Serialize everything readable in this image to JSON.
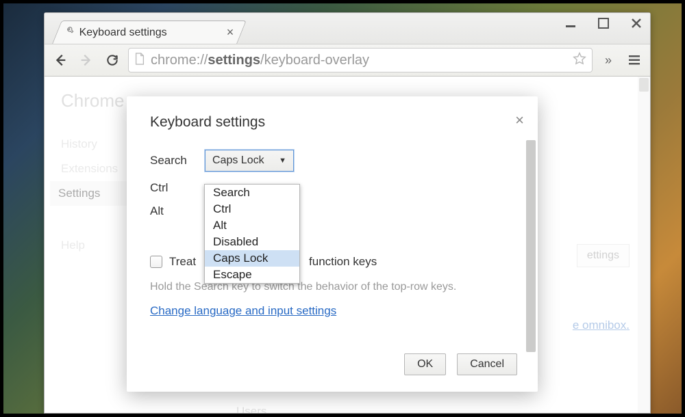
{
  "tab": {
    "title": "Keyboard settings"
  },
  "url": {
    "prefix": "chrome://",
    "bold": "settings",
    "suffix": "/keyboard-overlay"
  },
  "window_controls": {
    "minimize": "—",
    "maximize": "☐",
    "close": "✕"
  },
  "sidebar": {
    "title": "Chrome",
    "items": [
      "History",
      "Extensions",
      "Settings",
      "Help"
    ],
    "active_index": 2
  },
  "background": {
    "settings_button": "ettings",
    "omnibox_link_prefix": "e ",
    "omnibox_link": "omnibox",
    "omnibox_link_suffix": ".",
    "users_heading": "Users"
  },
  "dialog": {
    "title": "Keyboard settings",
    "rows": [
      {
        "label": "Search",
        "value": "Caps Lock"
      },
      {
        "label": "Ctrl"
      },
      {
        "label": "Alt"
      }
    ],
    "dropdown_options": [
      "Search",
      "Ctrl",
      "Alt",
      "Disabled",
      "Caps Lock",
      "Escape"
    ],
    "dropdown_selected": "Caps Lock",
    "checkbox_label_before": "Treat",
    "checkbox_label_after": "function keys",
    "hint": "Hold the Search key to switch the behavior of the top-row keys.",
    "link": "Change language and input settings",
    "ok": "OK",
    "cancel": "Cancel"
  }
}
